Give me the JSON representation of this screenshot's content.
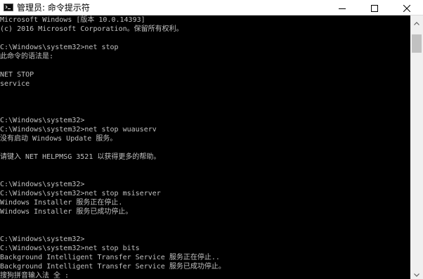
{
  "window": {
    "title": "管理员: 命令提示符",
    "controls": {
      "minimize": "minimize-icon",
      "maximize": "maximize-icon",
      "close": "close-icon"
    }
  },
  "terminal": {
    "lines": [
      "Microsoft Windows [版本 10.0.14393]",
      "(c) 2016 Microsoft Corporation。保留所有权利。",
      "",
      "C:\\Windows\\system32>net stop",
      "此命令的语法是:",
      "",
      "NET STOP",
      "service",
      "",
      "",
      "",
      "C:\\Windows\\system32>",
      "C:\\Windows\\system32>net stop wuauserv",
      "没有启动 Windows Update 服务。",
      "",
      "请键入 NET HELPMSG 3521 以获得更多的帮助。",
      "",
      "",
      "C:\\Windows\\system32>",
      "C:\\Windows\\system32>net stop msiserver",
      "Windows Installer 服务正在停止.",
      "Windows Installer 服务已成功停止。",
      "",
      "",
      "C:\\Windows\\system32>",
      "C:\\Windows\\system32>net stop bits",
      "Background Intelligent Transfer Service 服务正在停止..",
      "Background Intelligent Transfer Service 服务已成功停止。",
      "搜狗拼音输入法 全 :"
    ]
  },
  "colors": {
    "terminal_bg": "#000000",
    "terminal_fg": "#c0c0c0",
    "titlebar_bg": "#ffffff"
  }
}
